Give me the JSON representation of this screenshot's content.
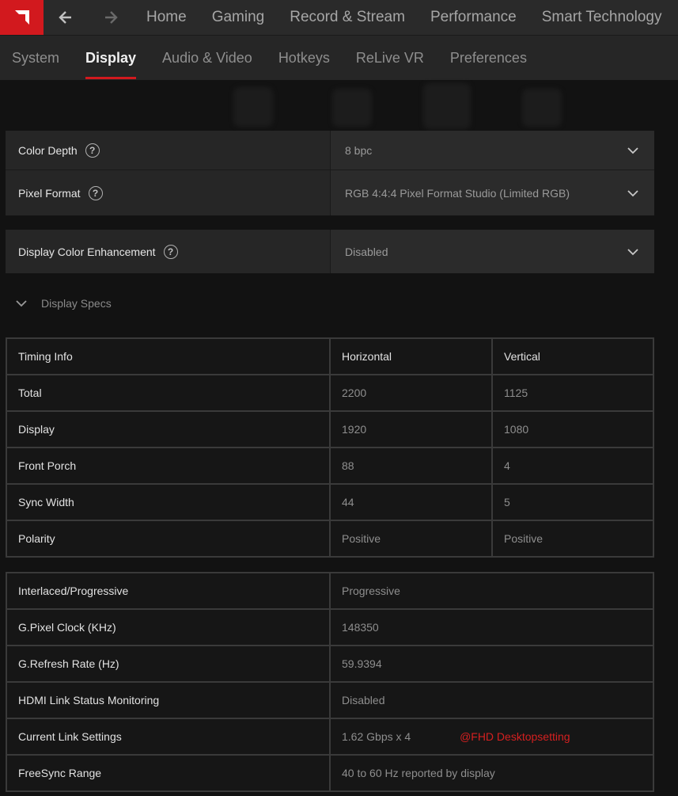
{
  "nav": {
    "logo": "amd-logo",
    "back_icon": "back-arrow-icon",
    "forward_icon": "forward-arrow-icon",
    "items": [
      "Home",
      "Gaming",
      "Record & Stream",
      "Performance",
      "Smart Technology"
    ]
  },
  "subnav": {
    "items": [
      "System",
      "Display",
      "Audio & Video",
      "Hotkeys",
      "ReLive VR",
      "Preferences"
    ],
    "active": "Display"
  },
  "settings": {
    "color_depth": {
      "label": "Color Depth",
      "value": "8 bpc"
    },
    "pixel_format": {
      "label": "Pixel Format",
      "value": "RGB 4:4:4 Pixel Format Studio (Limited RGB)"
    },
    "color_enhancement": {
      "label": "Display Color Enhancement",
      "value": "Disabled"
    }
  },
  "specs": {
    "toggle_label": "Display Specs",
    "timing": {
      "headers": [
        "Timing Info",
        "Horizontal",
        "Vertical"
      ],
      "rows": [
        [
          "Total",
          "2200",
          "1125"
        ],
        [
          "Display",
          "1920",
          "1080"
        ],
        [
          "Front Porch",
          "88",
          "4"
        ],
        [
          "Sync Width",
          "44",
          "5"
        ],
        [
          "Polarity",
          "Positive",
          "Positive"
        ]
      ]
    },
    "info": {
      "rows": [
        [
          "Interlaced/Progressive",
          "Progressive"
        ],
        [
          "G.Pixel Clock (KHz)",
          "148350"
        ],
        [
          "G.Refresh Rate (Hz)",
          "59.9394"
        ],
        [
          "HDMI Link Status Monitoring",
          "Disabled"
        ],
        [
          "Current Link Settings",
          "1.62 Gbps x 4"
        ],
        [
          "FreeSync Range",
          "40 to 60 Hz reported by display"
        ]
      ]
    },
    "watermark": "@FHD Desktopsetting"
  },
  "colors": {
    "accent": "#d2191e",
    "background": "#121212",
    "panel": "#262626"
  }
}
